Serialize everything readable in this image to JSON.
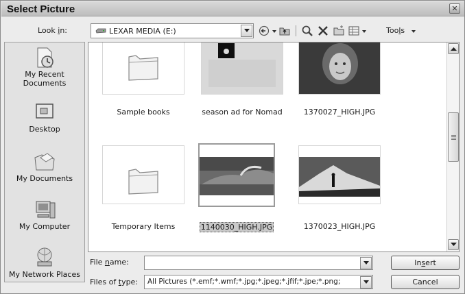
{
  "window": {
    "title": "Select Picture",
    "close_glyph": "✕"
  },
  "toolbar": {
    "look_in_label_pre": "Look ",
    "look_in_label_key": "i",
    "look_in_label_post": "n:",
    "look_in_value": "LEXAR MEDIA (E:)",
    "tools_label_pre": "Too",
    "tools_label_key": "l",
    "tools_label_post": "s",
    "icons": [
      "drive-icon",
      "back-icon",
      "up-folder-icon",
      "search-web-icon",
      "delete-icon",
      "new-folder-icon",
      "views-icon"
    ]
  },
  "places": [
    {
      "label": "My Recent Documents",
      "icon": "recent-docs-icon"
    },
    {
      "label": "Desktop",
      "icon": "desktop-icon"
    },
    {
      "label": "My Documents",
      "icon": "my-documents-icon"
    },
    {
      "label": "My Computer",
      "icon": "my-computer-icon"
    },
    {
      "label": "My Network Places",
      "icon": "network-places-icon"
    }
  ],
  "files": [
    {
      "name": "Sample books",
      "kind": "folder",
      "selected": false
    },
    {
      "name": "season ad for Nomad",
      "kind": "folder-with-image",
      "selected": false
    },
    {
      "name": "1370027_HIGH.JPG",
      "kind": "image-portrait",
      "selected": false
    },
    {
      "name": "Temporary Items",
      "kind": "folder",
      "selected": false
    },
    {
      "name": "1140030_HIGH.JPG",
      "kind": "image-wave",
      "selected": true
    },
    {
      "name": "1370023_HIGH.JPG",
      "kind": "image-mountain",
      "selected": false
    }
  ],
  "bottom": {
    "file_name_label_pre": "File ",
    "file_name_label_key": "n",
    "file_name_label_post": "ame:",
    "file_name_value": "",
    "file_type_label_pre": "Files of ",
    "file_type_label_key": "t",
    "file_type_label_post": "ype:",
    "file_type_value": "All Pictures (*.emf;*.wmf;*.jpg;*.jpeg;*.jfif;*.jpe;*.png;",
    "insert_label_pre": "In",
    "insert_label_key": "s",
    "insert_label_post": "ert",
    "cancel_label": "Cancel"
  }
}
